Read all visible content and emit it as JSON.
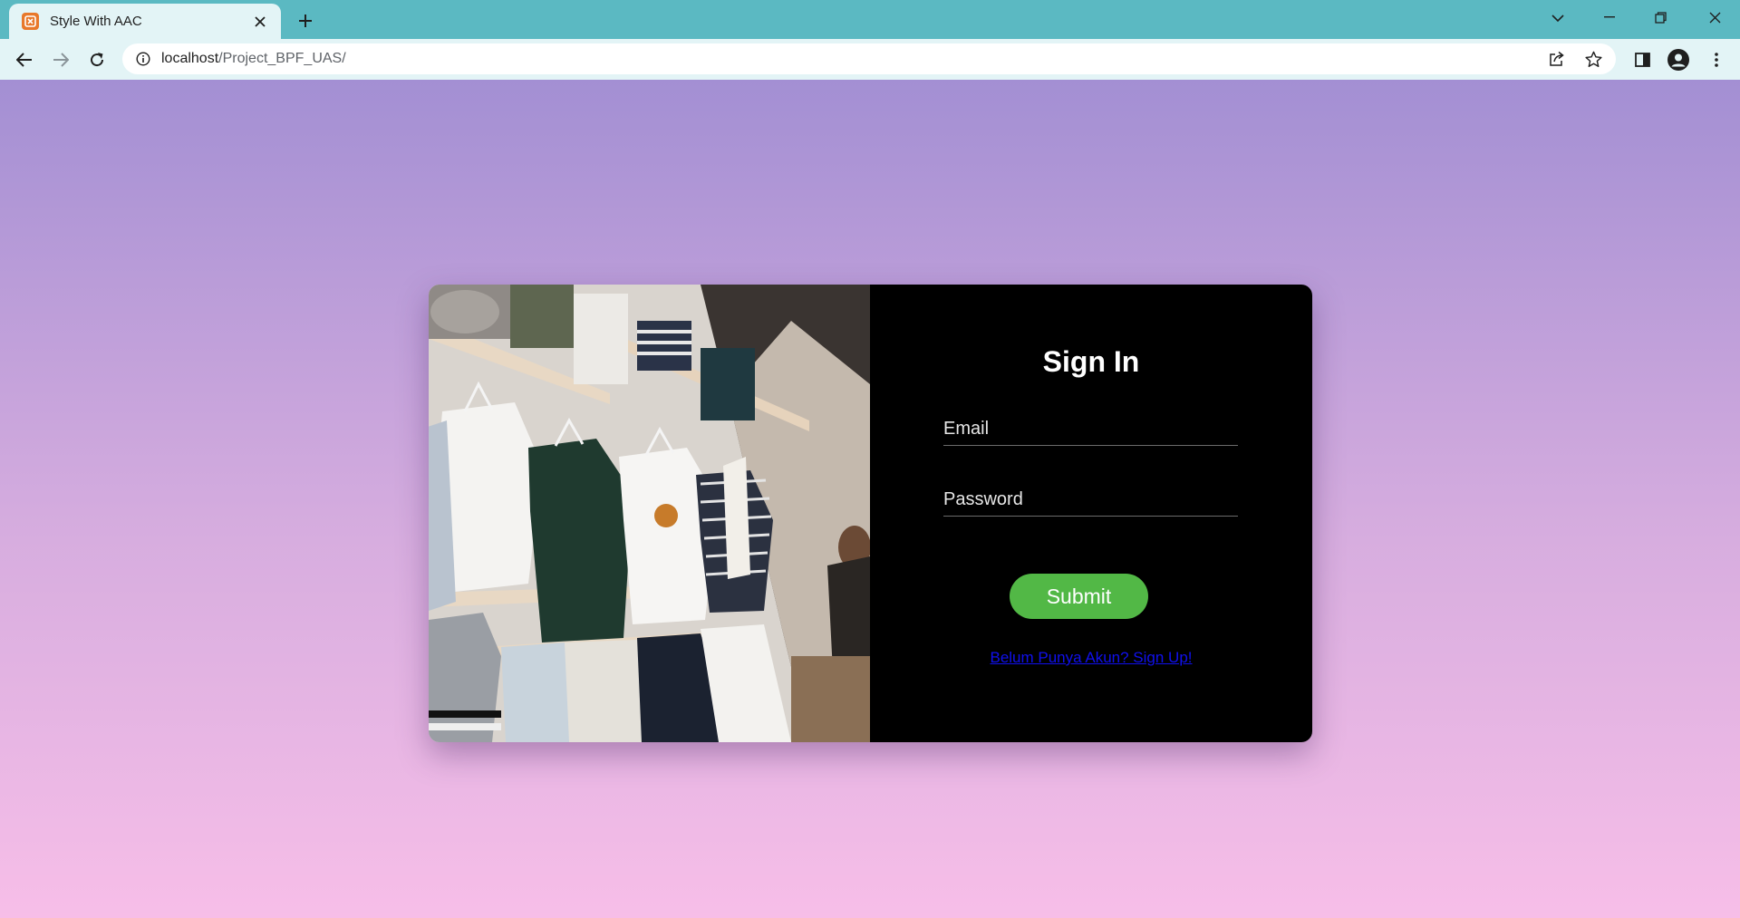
{
  "browser": {
    "tab": {
      "title": "Style With AAC",
      "favicon": "xampp-icon"
    },
    "address": {
      "host": "localhost",
      "path": "/Project_BPF_UAS/"
    },
    "colors": {
      "tabbar": "#5bb9c2",
      "toolbar": "#e3f4f6"
    }
  },
  "page": {
    "background_gradient": [
      "#a38fd3",
      "#d7addf",
      "#f7bee8"
    ],
    "hero_image": "clothing-store-rack-photo",
    "signin": {
      "title": "Sign In",
      "email_placeholder": "Email",
      "password_placeholder": "Password",
      "submit_label": "Submit",
      "signup_link": "Belum Punya Akun? Sign Up!"
    },
    "colors": {
      "form_bg": "#000000",
      "submit_bg": "#52b846",
      "link": "#1010ee"
    }
  }
}
